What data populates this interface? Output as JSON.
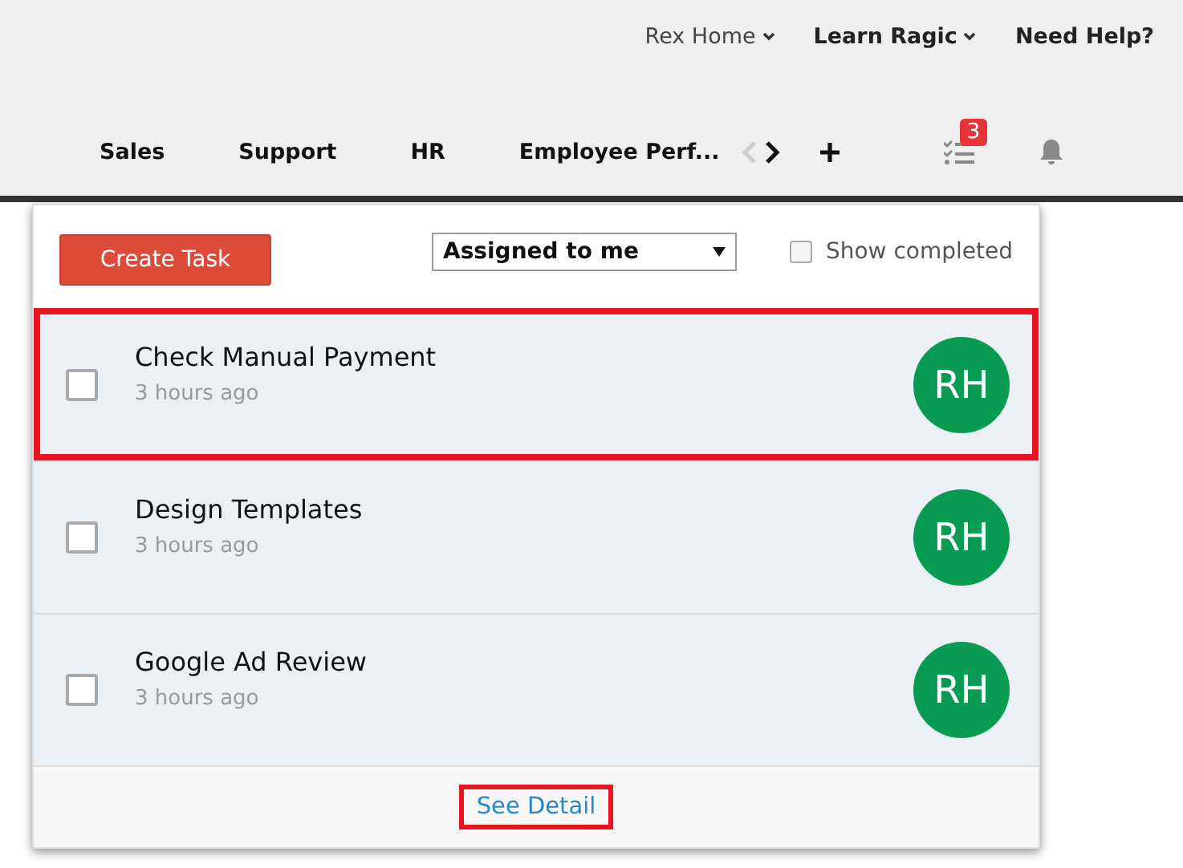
{
  "top_links": [
    {
      "label": "Rex Home",
      "bold": false,
      "dropdown": true
    },
    {
      "label": "Learn Ragic",
      "bold": true,
      "dropdown": true
    },
    {
      "label": "Need Help?",
      "bold": true,
      "dropdown": false
    }
  ],
  "tabs": [
    {
      "label": "Sales"
    },
    {
      "label": "Support"
    },
    {
      "label": "HR"
    },
    {
      "label": "Employee Perf..."
    }
  ],
  "tab_nav": {
    "prev_disabled": true,
    "next_disabled": false
  },
  "tasks_badge": "3",
  "popup": {
    "create_button": "Create Task",
    "filter": {
      "value": "Assigned to me"
    },
    "show_completed": {
      "label": "Show completed",
      "checked": false
    },
    "tasks": [
      {
        "title": "Check Manual Payment",
        "time": "3 hours ago",
        "assignee": "RH",
        "checked": false,
        "highlighted": true
      },
      {
        "title": "Design Templates",
        "time": "3 hours ago",
        "assignee": "RH",
        "checked": false,
        "highlighted": false
      },
      {
        "title": "Google Ad Review",
        "time": "3 hours ago",
        "assignee": "RH",
        "checked": false,
        "highlighted": false
      }
    ],
    "footer_link": {
      "label": "See Detail",
      "highlighted": true
    }
  }
}
